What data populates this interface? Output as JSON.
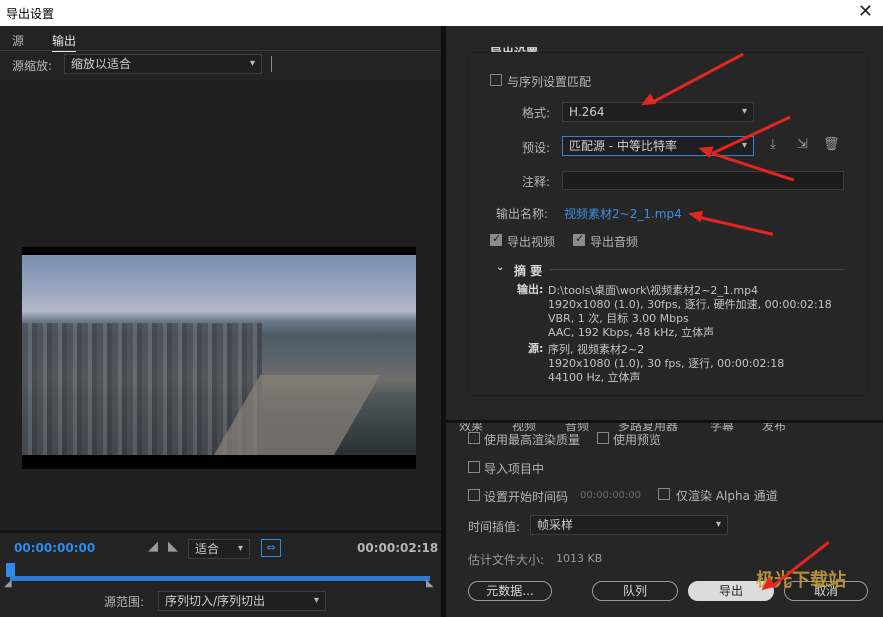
{
  "window": {
    "title": "导出设置",
    "close_glyph": "✕"
  },
  "left": {
    "tabs": [
      {
        "label": "源"
      },
      {
        "label": "输出"
      }
    ],
    "source_scale_label": "源缩放:",
    "source_scale_value": "缩放以适合",
    "timecode_start": "00:00:00:00",
    "timecode_end": "00:00:02:18",
    "fit_value": "适合",
    "source_range_label": "源范围:",
    "source_range_value": "序列切入/序列切出"
  },
  "export_settings": {
    "section_title": "导出设置",
    "match_sequence_label": "与序列设置匹配",
    "match_sequence_checked": false,
    "format_label": "格式:",
    "format_value": "H.264",
    "preset_label": "预设:",
    "preset_value": "匹配源 - 中等比特率",
    "comment_label": "注释:",
    "comment_value": "",
    "output_name_label": "输出名称:",
    "output_name_value": "视频素材2~2_1.mp4",
    "export_video_label": "导出视频",
    "export_video_checked": true,
    "export_audio_label": "导出音频",
    "export_audio_checked": true,
    "summary_title": "摘 要",
    "output_label": "输出:",
    "output_lines": [
      "D:\\tools\\桌面\\work\\视频素材2~2_1.mp4",
      "1920x1080 (1.0), 30fps, 逐行, 硬件加速, 00:00:02:18",
      "VBR, 1 次, 目标 3.00 Mbps",
      "AAC, 192 Kbps, 48  kHz, 立体声"
    ],
    "source_label": "源:",
    "source_lines": [
      "序列, 视频素材2~2",
      "1920x1080 (1.0), 30 fps, 逐行, 00:00:02:18",
      "44100 Hz, 立体声"
    ]
  },
  "tabs2": [
    {
      "label": "效果"
    },
    {
      "label": "视频"
    },
    {
      "label": "音频"
    },
    {
      "label": "多路复用器"
    },
    {
      "label": "字幕"
    },
    {
      "label": "发布"
    }
  ],
  "options": {
    "max_render_label": "使用最高渲染质量",
    "use_preview_label": "使用预览",
    "import_project_label": "导入项目中",
    "set_start_tc_label": "设置开始时间码",
    "start_tc_value": "00:00:00:00",
    "alpha_only_label": "仅渲染 Alpha 通道",
    "time_interp_label": "时间插值:",
    "time_interp_value": "帧采样",
    "est_size_label": "估计文件大小:",
    "est_size_value": "1013 KB"
  },
  "buttons": {
    "metadata": "元数据...",
    "queue": "队列",
    "export": "导出",
    "cancel": "取消"
  },
  "watermark": "极光下载站",
  "colors": {
    "accent_blue": "#2d8ceb",
    "arrow_red": "#e3261f",
    "link_blue": "#3d8fe0"
  }
}
